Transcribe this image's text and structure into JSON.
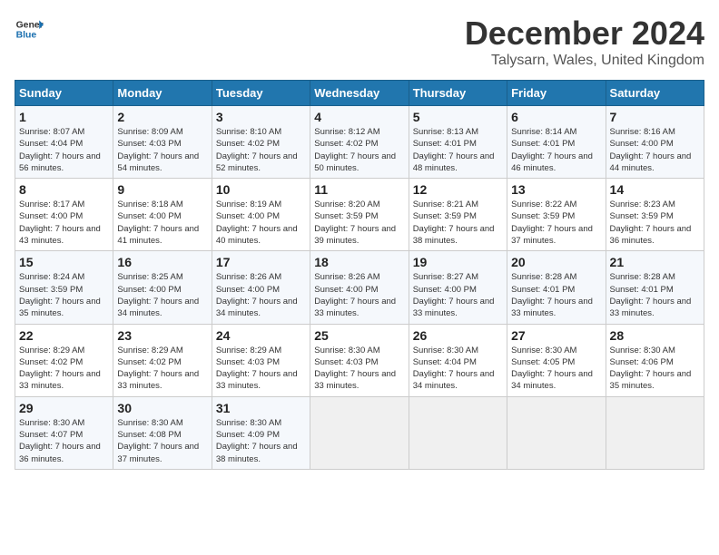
{
  "logo": {
    "line1": "General",
    "line2": "Blue"
  },
  "title": "December 2024",
  "subtitle": "Talysarn, Wales, United Kingdom",
  "headers": [
    "Sunday",
    "Monday",
    "Tuesday",
    "Wednesday",
    "Thursday",
    "Friday",
    "Saturday"
  ],
  "weeks": [
    [
      {
        "day": "1",
        "sunrise": "Sunrise: 8:07 AM",
        "sunset": "Sunset: 4:04 PM",
        "daylight": "Daylight: 7 hours and 56 minutes."
      },
      {
        "day": "2",
        "sunrise": "Sunrise: 8:09 AM",
        "sunset": "Sunset: 4:03 PM",
        "daylight": "Daylight: 7 hours and 54 minutes."
      },
      {
        "day": "3",
        "sunrise": "Sunrise: 8:10 AM",
        "sunset": "Sunset: 4:02 PM",
        "daylight": "Daylight: 7 hours and 52 minutes."
      },
      {
        "day": "4",
        "sunrise": "Sunrise: 8:12 AM",
        "sunset": "Sunset: 4:02 PM",
        "daylight": "Daylight: 7 hours and 50 minutes."
      },
      {
        "day": "5",
        "sunrise": "Sunrise: 8:13 AM",
        "sunset": "Sunset: 4:01 PM",
        "daylight": "Daylight: 7 hours and 48 minutes."
      },
      {
        "day": "6",
        "sunrise": "Sunrise: 8:14 AM",
        "sunset": "Sunset: 4:01 PM",
        "daylight": "Daylight: 7 hours and 46 minutes."
      },
      {
        "day": "7",
        "sunrise": "Sunrise: 8:16 AM",
        "sunset": "Sunset: 4:00 PM",
        "daylight": "Daylight: 7 hours and 44 minutes."
      }
    ],
    [
      {
        "day": "8",
        "sunrise": "Sunrise: 8:17 AM",
        "sunset": "Sunset: 4:00 PM",
        "daylight": "Daylight: 7 hours and 43 minutes."
      },
      {
        "day": "9",
        "sunrise": "Sunrise: 8:18 AM",
        "sunset": "Sunset: 4:00 PM",
        "daylight": "Daylight: 7 hours and 41 minutes."
      },
      {
        "day": "10",
        "sunrise": "Sunrise: 8:19 AM",
        "sunset": "Sunset: 4:00 PM",
        "daylight": "Daylight: 7 hours and 40 minutes."
      },
      {
        "day": "11",
        "sunrise": "Sunrise: 8:20 AM",
        "sunset": "Sunset: 3:59 PM",
        "daylight": "Daylight: 7 hours and 39 minutes."
      },
      {
        "day": "12",
        "sunrise": "Sunrise: 8:21 AM",
        "sunset": "Sunset: 3:59 PM",
        "daylight": "Daylight: 7 hours and 38 minutes."
      },
      {
        "day": "13",
        "sunrise": "Sunrise: 8:22 AM",
        "sunset": "Sunset: 3:59 PM",
        "daylight": "Daylight: 7 hours and 37 minutes."
      },
      {
        "day": "14",
        "sunrise": "Sunrise: 8:23 AM",
        "sunset": "Sunset: 3:59 PM",
        "daylight": "Daylight: 7 hours and 36 minutes."
      }
    ],
    [
      {
        "day": "15",
        "sunrise": "Sunrise: 8:24 AM",
        "sunset": "Sunset: 3:59 PM",
        "daylight": "Daylight: 7 hours and 35 minutes."
      },
      {
        "day": "16",
        "sunrise": "Sunrise: 8:25 AM",
        "sunset": "Sunset: 4:00 PM",
        "daylight": "Daylight: 7 hours and 34 minutes."
      },
      {
        "day": "17",
        "sunrise": "Sunrise: 8:26 AM",
        "sunset": "Sunset: 4:00 PM",
        "daylight": "Daylight: 7 hours and 34 minutes."
      },
      {
        "day": "18",
        "sunrise": "Sunrise: 8:26 AM",
        "sunset": "Sunset: 4:00 PM",
        "daylight": "Daylight: 7 hours and 33 minutes."
      },
      {
        "day": "19",
        "sunrise": "Sunrise: 8:27 AM",
        "sunset": "Sunset: 4:00 PM",
        "daylight": "Daylight: 7 hours and 33 minutes."
      },
      {
        "day": "20",
        "sunrise": "Sunrise: 8:28 AM",
        "sunset": "Sunset: 4:01 PM",
        "daylight": "Daylight: 7 hours and 33 minutes."
      },
      {
        "day": "21",
        "sunrise": "Sunrise: 8:28 AM",
        "sunset": "Sunset: 4:01 PM",
        "daylight": "Daylight: 7 hours and 33 minutes."
      }
    ],
    [
      {
        "day": "22",
        "sunrise": "Sunrise: 8:29 AM",
        "sunset": "Sunset: 4:02 PM",
        "daylight": "Daylight: 7 hours and 33 minutes."
      },
      {
        "day": "23",
        "sunrise": "Sunrise: 8:29 AM",
        "sunset": "Sunset: 4:02 PM",
        "daylight": "Daylight: 7 hours and 33 minutes."
      },
      {
        "day": "24",
        "sunrise": "Sunrise: 8:29 AM",
        "sunset": "Sunset: 4:03 PM",
        "daylight": "Daylight: 7 hours and 33 minutes."
      },
      {
        "day": "25",
        "sunrise": "Sunrise: 8:30 AM",
        "sunset": "Sunset: 4:03 PM",
        "daylight": "Daylight: 7 hours and 33 minutes."
      },
      {
        "day": "26",
        "sunrise": "Sunrise: 8:30 AM",
        "sunset": "Sunset: 4:04 PM",
        "daylight": "Daylight: 7 hours and 34 minutes."
      },
      {
        "day": "27",
        "sunrise": "Sunrise: 8:30 AM",
        "sunset": "Sunset: 4:05 PM",
        "daylight": "Daylight: 7 hours and 34 minutes."
      },
      {
        "day": "28",
        "sunrise": "Sunrise: 8:30 AM",
        "sunset": "Sunset: 4:06 PM",
        "daylight": "Daylight: 7 hours and 35 minutes."
      }
    ],
    [
      {
        "day": "29",
        "sunrise": "Sunrise: 8:30 AM",
        "sunset": "Sunset: 4:07 PM",
        "daylight": "Daylight: 7 hours and 36 minutes."
      },
      {
        "day": "30",
        "sunrise": "Sunrise: 8:30 AM",
        "sunset": "Sunset: 4:08 PM",
        "daylight": "Daylight: 7 hours and 37 minutes."
      },
      {
        "day": "31",
        "sunrise": "Sunrise: 8:30 AM",
        "sunset": "Sunset: 4:09 PM",
        "daylight": "Daylight: 7 hours and 38 minutes."
      },
      null,
      null,
      null,
      null
    ]
  ]
}
